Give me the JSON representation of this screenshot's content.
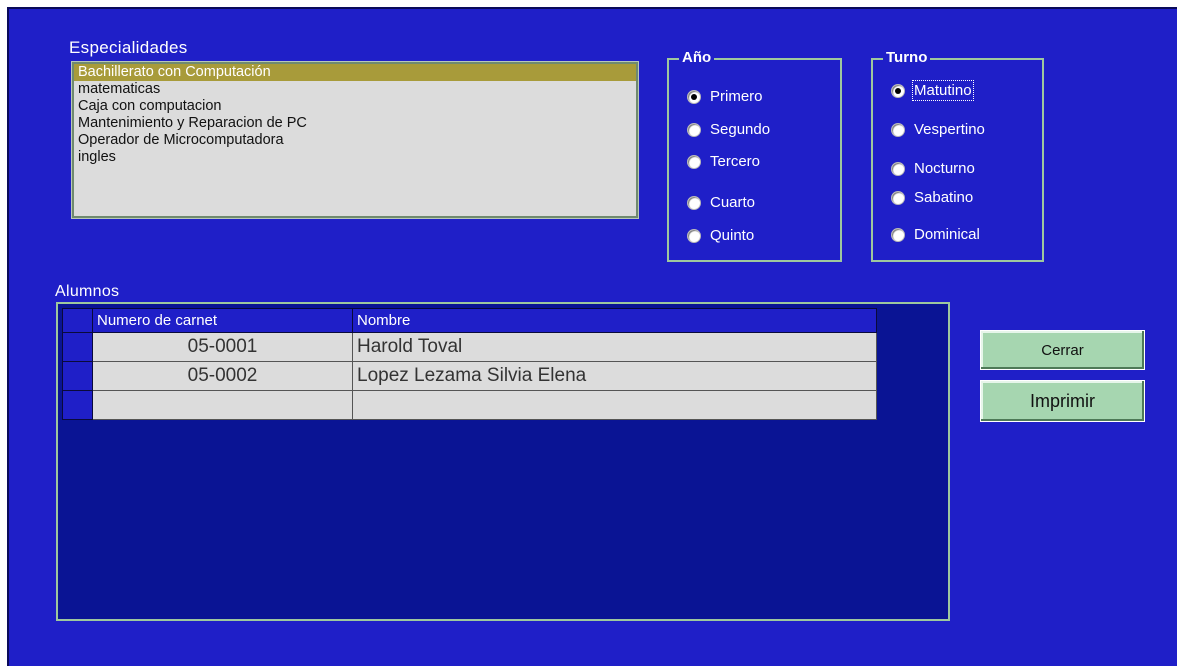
{
  "especialidades": {
    "caption": "Especialidades",
    "items": [
      "Bachillerato con Computación",
      "matematicas",
      "Caja con computacion",
      "Mantenimiento y Reparacion de PC",
      "Operador de Microcomputadora",
      "ingles"
    ],
    "selected_index": 0
  },
  "anio": {
    "title": "Año",
    "options": [
      "Primero",
      "Segundo",
      "Tercero",
      "Cuarto",
      "Quinto"
    ],
    "selected": "Primero"
  },
  "turno": {
    "title": "Turno",
    "options": [
      "Matutino",
      "Vespertino",
      "Nocturno",
      "Sabatino",
      "Dominical"
    ],
    "selected": "Matutino"
  },
  "alumnos": {
    "caption": "Alumnos",
    "columns": [
      "Numero de carnet",
      "Nombre"
    ],
    "rows": [
      [
        "05-0001",
        "Harold Toval"
      ],
      [
        "05-0002",
        "Lopez Lezama Silvia Elena"
      ],
      [
        "",
        ""
      ]
    ]
  },
  "buttons": {
    "cerrar": "Cerrar",
    "imprimir": "Imprimir"
  },
  "colors": {
    "form_background": "#1f1fc8",
    "list_selection": "#a89b3a",
    "button_face": "#a6d6b0",
    "grid_background": "#0a1494"
  }
}
